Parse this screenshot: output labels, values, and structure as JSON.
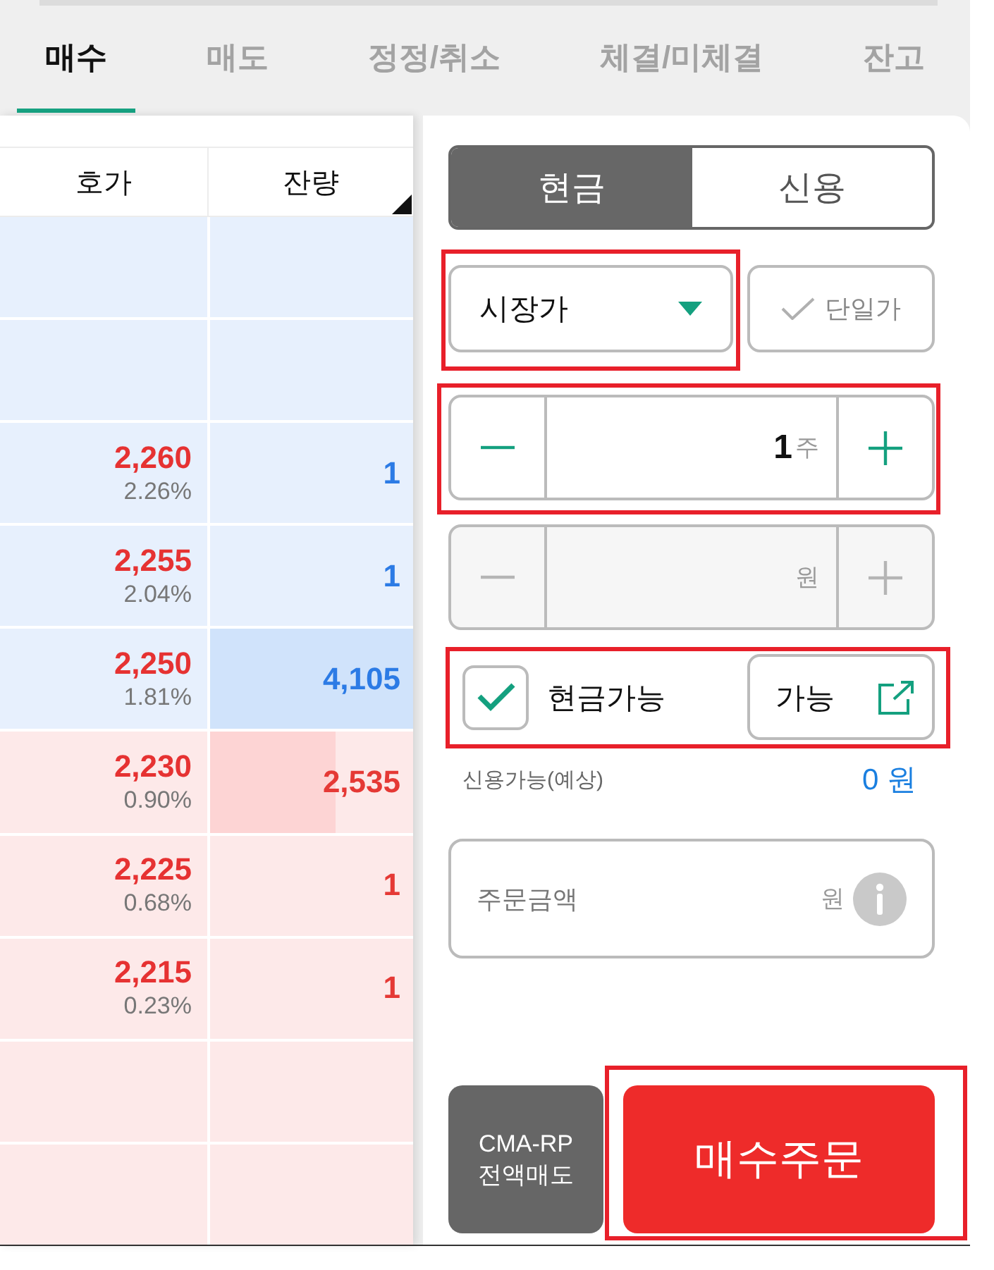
{
  "tabs": [
    {
      "label": "매수",
      "selected": true
    },
    {
      "label": "매도",
      "selected": false
    },
    {
      "label": "정정/취소",
      "selected": false
    },
    {
      "label": "체결/미체결",
      "selected": false
    },
    {
      "label": "잔고",
      "selected": false
    }
  ],
  "order_book": {
    "columns": [
      "호가",
      "잔량"
    ],
    "rows": [
      {
        "kind": "ask"
      },
      {
        "kind": "ask"
      },
      {
        "kind": "ask",
        "price": "2,260",
        "change": "2.26%",
        "quantity": "1"
      },
      {
        "kind": "ask",
        "price": "2,255",
        "change": "2.04%",
        "quantity": "1"
      },
      {
        "kind": "ask",
        "price": "2,250",
        "change": "1.81%",
        "quantity": "4,105",
        "level": 1
      },
      {
        "kind": "bid",
        "price": "2,230",
        "change": "0.90%",
        "quantity": "2,535",
        "level": 0.62
      },
      {
        "kind": "bid",
        "price": "2,225",
        "change": "0.68%",
        "quantity": "1"
      },
      {
        "kind": "bid",
        "price": "2,215",
        "change": "0.23%",
        "quantity": "1"
      },
      {
        "kind": "bid"
      },
      {
        "kind": "bid"
      }
    ]
  },
  "order_form": {
    "payment_tabs": [
      {
        "label": "현금",
        "selected": true
      },
      {
        "label": "신용",
        "selected": false
      }
    ],
    "order_type": {
      "value": "시장가",
      "highlighted": true
    },
    "single_price": {
      "label": "단일가",
      "checked": false
    },
    "quantity": {
      "value": "1",
      "unit": "주",
      "disabled": false,
      "highlighted": true
    },
    "price": {
      "unit": "원",
      "disabled": true
    },
    "cash_available": {
      "label": "현금가능",
      "checked": true,
      "button": "가능",
      "highlighted": true
    },
    "credit_available": {
      "label": "신용가능(예상)",
      "value": "0 원"
    },
    "order_amount": {
      "label": "주문금액",
      "unit": "원"
    },
    "buttons": [
      {
        "label": "CMA-RP 전액매도",
        "kind": "secondary"
      },
      {
        "label": "매수주문",
        "kind": "primary",
        "highlighted": true
      }
    ]
  }
}
